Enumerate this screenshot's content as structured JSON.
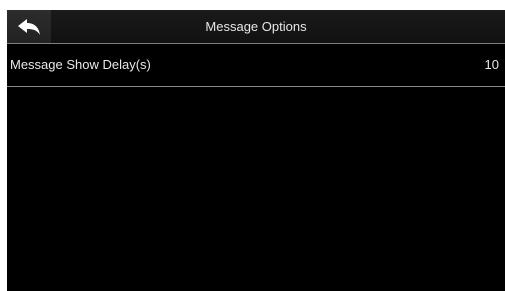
{
  "header": {
    "title": "Message Options",
    "back_icon": "back-arrow-icon"
  },
  "settings": {
    "items": [
      {
        "label": "Message Show Delay(s)",
        "value": "10"
      }
    ]
  },
  "colors": {
    "background": "#000000",
    "text": "#e8e8e8",
    "divider": "#8a8a8a"
  }
}
